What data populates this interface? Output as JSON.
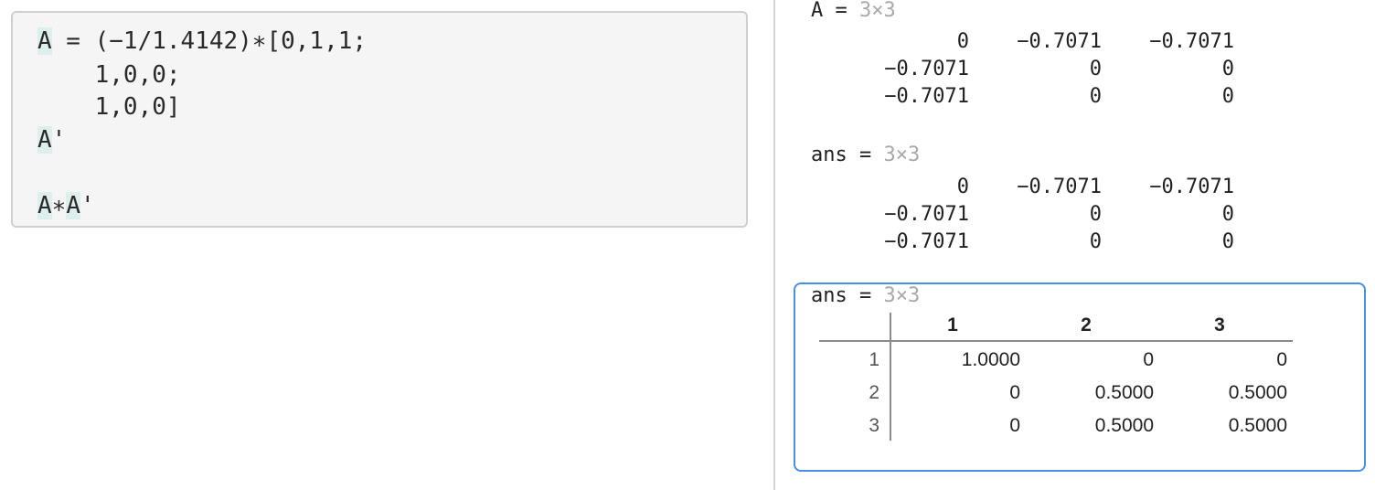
{
  "code": {
    "lines": [
      {
        "hl": "A",
        "rest": " = (−1/1.4142)∗[0,1,1;"
      },
      {
        "text": "    1,0,0;"
      },
      {
        "text": "    1,0,0]"
      },
      {
        "hl": "A",
        "rest": "'"
      },
      {
        "text": ""
      },
      {
        "hl1": "A",
        "mid": "∗",
        "hl2": "A",
        "rest": "'"
      }
    ]
  },
  "output1": {
    "var": "A",
    "eq": " = ",
    "size": "3×3",
    "rows": [
      [
        "0",
        "−0.7071",
        "−0.7071"
      ],
      [
        "−0.7071",
        "0",
        "0"
      ],
      [
        "−0.7071",
        "0",
        "0"
      ]
    ]
  },
  "output2": {
    "var": "ans",
    "eq": " = ",
    "size": "3×3",
    "rows": [
      [
        "0",
        "−0.7071",
        "−0.7071"
      ],
      [
        "−0.7071",
        "0",
        "0"
      ],
      [
        "−0.7071",
        "0",
        "0"
      ]
    ]
  },
  "output3": {
    "var": "ans",
    "eq": " = ",
    "size": "3×3",
    "col_headers": [
      "1",
      "2",
      "3"
    ],
    "row_headers": [
      "1",
      "2",
      "3"
    ],
    "rows": [
      [
        "1.0000",
        "0",
        "0"
      ],
      [
        "0",
        "0.5000",
        "0.5000"
      ],
      [
        "0",
        "0.5000",
        "0.5000"
      ]
    ]
  },
  "colors": {
    "highlight": "#dcefec",
    "selection_border": "#4a90e2"
  }
}
